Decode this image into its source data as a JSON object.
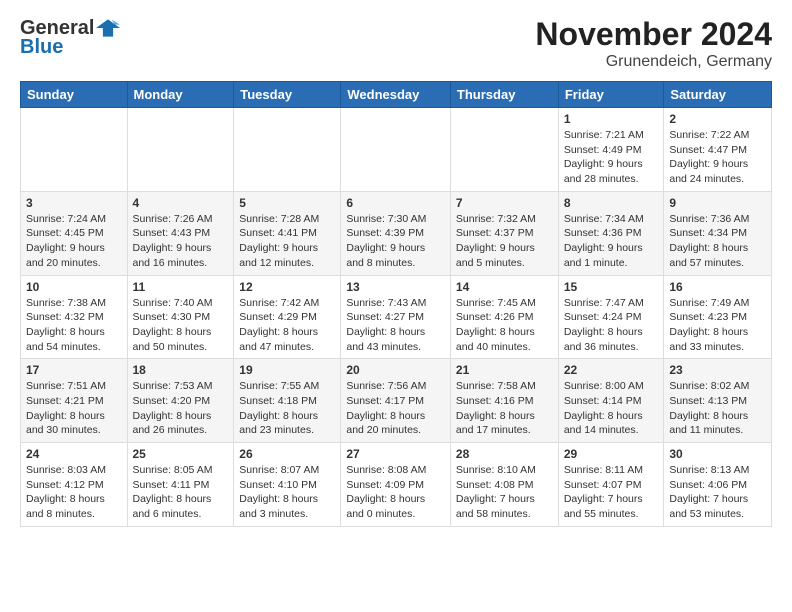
{
  "logo": {
    "general": "General",
    "blue": "Blue"
  },
  "header": {
    "month": "November 2024",
    "location": "Grunendeich, Germany"
  },
  "days_of_week": [
    "Sunday",
    "Monday",
    "Tuesday",
    "Wednesday",
    "Thursday",
    "Friday",
    "Saturday"
  ],
  "weeks": [
    [
      {
        "day": "",
        "info": ""
      },
      {
        "day": "",
        "info": ""
      },
      {
        "day": "",
        "info": ""
      },
      {
        "day": "",
        "info": ""
      },
      {
        "day": "",
        "info": ""
      },
      {
        "day": "1",
        "info": "Sunrise: 7:21 AM\nSunset: 4:49 PM\nDaylight: 9 hours and 28 minutes."
      },
      {
        "day": "2",
        "info": "Sunrise: 7:22 AM\nSunset: 4:47 PM\nDaylight: 9 hours and 24 minutes."
      }
    ],
    [
      {
        "day": "3",
        "info": "Sunrise: 7:24 AM\nSunset: 4:45 PM\nDaylight: 9 hours and 20 minutes."
      },
      {
        "day": "4",
        "info": "Sunrise: 7:26 AM\nSunset: 4:43 PM\nDaylight: 9 hours and 16 minutes."
      },
      {
        "day": "5",
        "info": "Sunrise: 7:28 AM\nSunset: 4:41 PM\nDaylight: 9 hours and 12 minutes."
      },
      {
        "day": "6",
        "info": "Sunrise: 7:30 AM\nSunset: 4:39 PM\nDaylight: 9 hours and 8 minutes."
      },
      {
        "day": "7",
        "info": "Sunrise: 7:32 AM\nSunset: 4:37 PM\nDaylight: 9 hours and 5 minutes."
      },
      {
        "day": "8",
        "info": "Sunrise: 7:34 AM\nSunset: 4:36 PM\nDaylight: 9 hours and 1 minute."
      },
      {
        "day": "9",
        "info": "Sunrise: 7:36 AM\nSunset: 4:34 PM\nDaylight: 8 hours and 57 minutes."
      }
    ],
    [
      {
        "day": "10",
        "info": "Sunrise: 7:38 AM\nSunset: 4:32 PM\nDaylight: 8 hours and 54 minutes."
      },
      {
        "day": "11",
        "info": "Sunrise: 7:40 AM\nSunset: 4:30 PM\nDaylight: 8 hours and 50 minutes."
      },
      {
        "day": "12",
        "info": "Sunrise: 7:42 AM\nSunset: 4:29 PM\nDaylight: 8 hours and 47 minutes."
      },
      {
        "day": "13",
        "info": "Sunrise: 7:43 AM\nSunset: 4:27 PM\nDaylight: 8 hours and 43 minutes."
      },
      {
        "day": "14",
        "info": "Sunrise: 7:45 AM\nSunset: 4:26 PM\nDaylight: 8 hours and 40 minutes."
      },
      {
        "day": "15",
        "info": "Sunrise: 7:47 AM\nSunset: 4:24 PM\nDaylight: 8 hours and 36 minutes."
      },
      {
        "day": "16",
        "info": "Sunrise: 7:49 AM\nSunset: 4:23 PM\nDaylight: 8 hours and 33 minutes."
      }
    ],
    [
      {
        "day": "17",
        "info": "Sunrise: 7:51 AM\nSunset: 4:21 PM\nDaylight: 8 hours and 30 minutes."
      },
      {
        "day": "18",
        "info": "Sunrise: 7:53 AM\nSunset: 4:20 PM\nDaylight: 8 hours and 26 minutes."
      },
      {
        "day": "19",
        "info": "Sunrise: 7:55 AM\nSunset: 4:18 PM\nDaylight: 8 hours and 23 minutes."
      },
      {
        "day": "20",
        "info": "Sunrise: 7:56 AM\nSunset: 4:17 PM\nDaylight: 8 hours and 20 minutes."
      },
      {
        "day": "21",
        "info": "Sunrise: 7:58 AM\nSunset: 4:16 PM\nDaylight: 8 hours and 17 minutes."
      },
      {
        "day": "22",
        "info": "Sunrise: 8:00 AM\nSunset: 4:14 PM\nDaylight: 8 hours and 14 minutes."
      },
      {
        "day": "23",
        "info": "Sunrise: 8:02 AM\nSunset: 4:13 PM\nDaylight: 8 hours and 11 minutes."
      }
    ],
    [
      {
        "day": "24",
        "info": "Sunrise: 8:03 AM\nSunset: 4:12 PM\nDaylight: 8 hours and 8 minutes."
      },
      {
        "day": "25",
        "info": "Sunrise: 8:05 AM\nSunset: 4:11 PM\nDaylight: 8 hours and 6 minutes."
      },
      {
        "day": "26",
        "info": "Sunrise: 8:07 AM\nSunset: 4:10 PM\nDaylight: 8 hours and 3 minutes."
      },
      {
        "day": "27",
        "info": "Sunrise: 8:08 AM\nSunset: 4:09 PM\nDaylight: 8 hours and 0 minutes."
      },
      {
        "day": "28",
        "info": "Sunrise: 8:10 AM\nSunset: 4:08 PM\nDaylight: 7 hours and 58 minutes."
      },
      {
        "day": "29",
        "info": "Sunrise: 8:11 AM\nSunset: 4:07 PM\nDaylight: 7 hours and 55 minutes."
      },
      {
        "day": "30",
        "info": "Sunrise: 8:13 AM\nSunset: 4:06 PM\nDaylight: 7 hours and 53 minutes."
      }
    ]
  ]
}
